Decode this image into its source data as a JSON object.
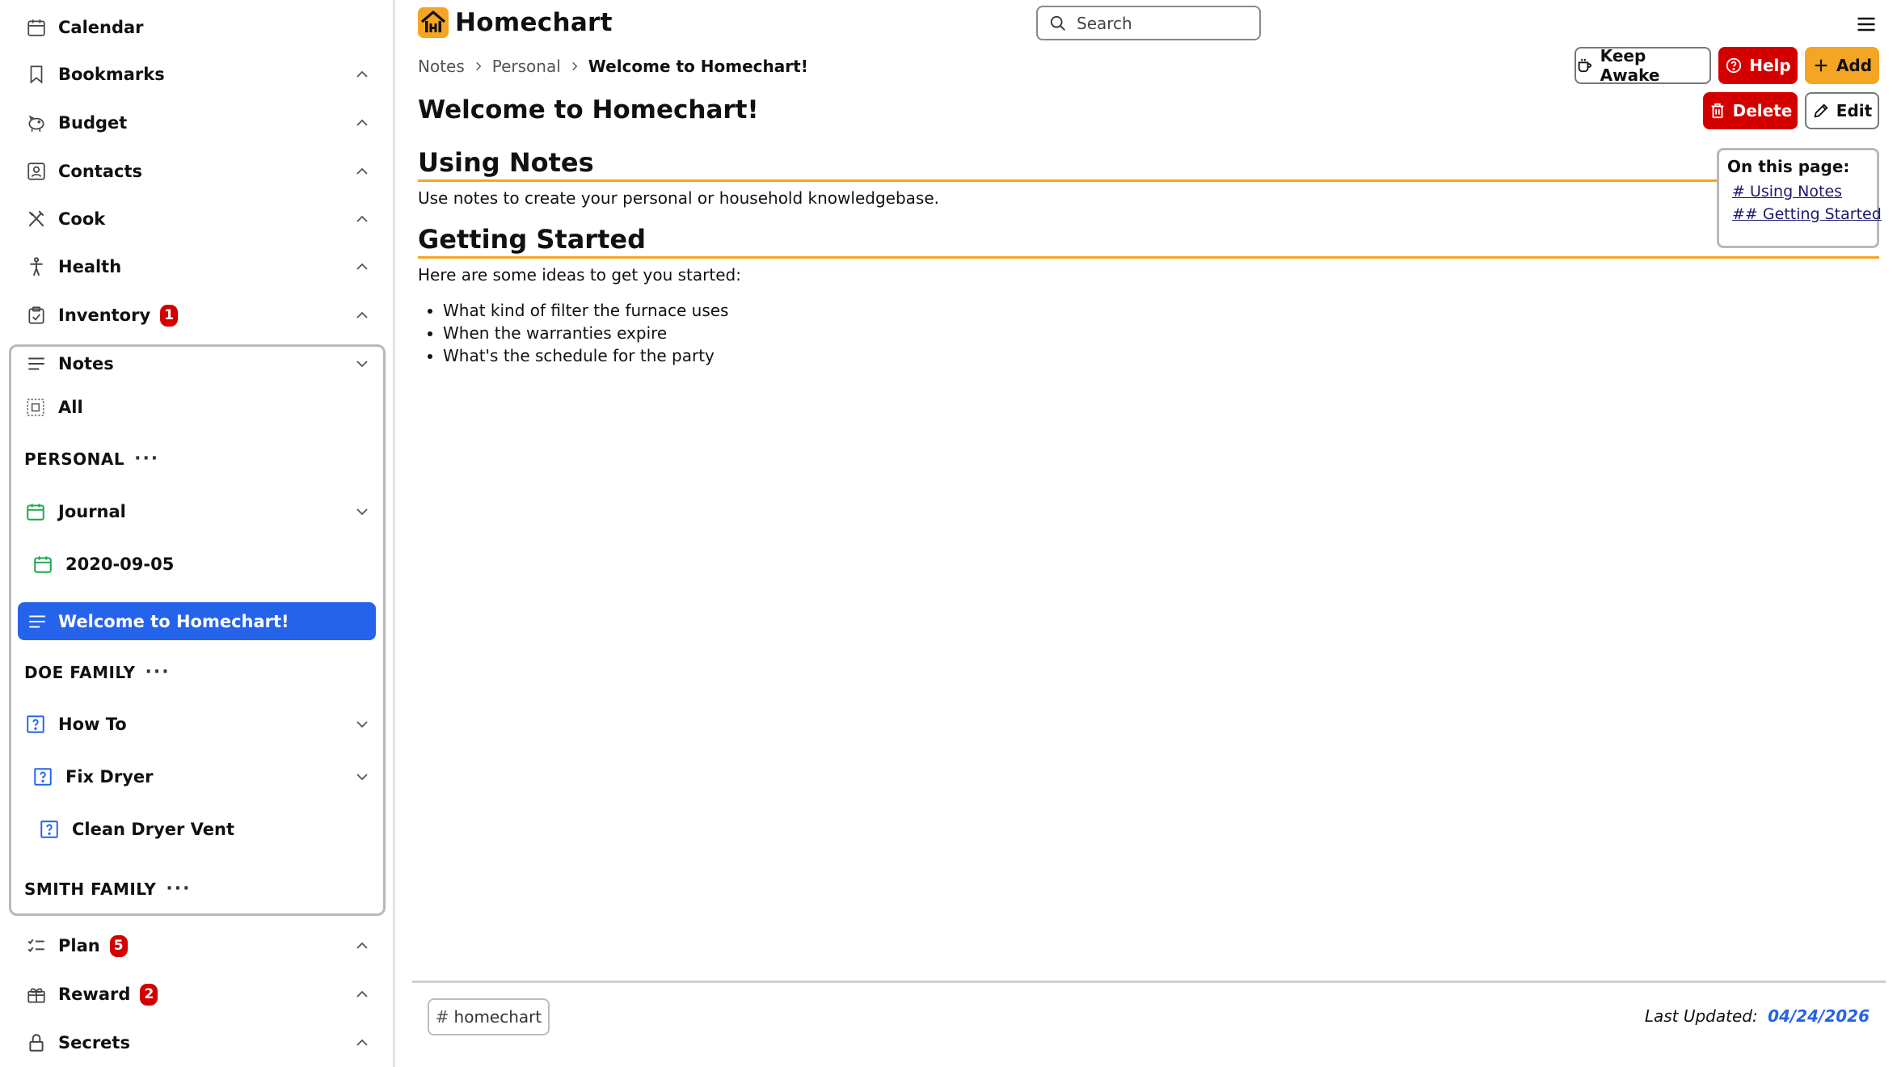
{
  "app": {
    "title": "Homechart"
  },
  "search": {
    "placeholder": "Search"
  },
  "colors": {
    "accent": "#f5a524",
    "primary": "#2563eb",
    "danger": "#d40000",
    "success": "#1aa54a"
  },
  "sidebar": {
    "items": [
      {
        "label": "Calendar",
        "icon": "calendar-icon"
      },
      {
        "label": "Bookmarks",
        "icon": "bookmark-icon"
      },
      {
        "label": "Budget",
        "icon": "piggy-bank-icon"
      },
      {
        "label": "Contacts",
        "icon": "contact-card-icon"
      },
      {
        "label": "Cook",
        "icon": "utensils-icon"
      },
      {
        "label": "Health",
        "icon": "person-icon"
      },
      {
        "label": "Inventory",
        "icon": "clipboard-check-icon",
        "badge": "1"
      },
      {
        "label": "Notes",
        "icon": "notes-lines-icon"
      },
      {
        "label": "Plan",
        "icon": "checklist-icon",
        "badge": "5"
      },
      {
        "label": "Reward",
        "icon": "gift-icon",
        "badge": "2"
      },
      {
        "label": "Secrets",
        "icon": "lock-icon"
      }
    ],
    "notes": {
      "all_label": "All",
      "personal_heading": "PERSONAL",
      "journal_label": "Journal",
      "journal_entry_label": "2020-09-05",
      "active_note_label": "Welcome to Homechart!",
      "doe_heading": "DOE FAMILY",
      "howto_label": "How To",
      "fix_dryer_label": "Fix Dryer",
      "clean_vent_label": "Clean Dryer Vent",
      "smith_heading": "SMITH FAMILY",
      "dots": "···"
    }
  },
  "breadcrumb": {
    "level1": "Notes",
    "level2": "Personal",
    "current": "Welcome to Homechart!"
  },
  "toolbar": {
    "keep_awake_label": "Keep Awake",
    "help_label": "Help",
    "add_label": "Add",
    "delete_label": "Delete",
    "edit_label": "Edit"
  },
  "note": {
    "title": "Welcome to Homechart!",
    "section1_heading": "Using Notes",
    "section1_text": "Use notes to create your personal or household knowledgebase.",
    "section2_heading": "Getting Started",
    "section2_intro": "Here are some ideas to get you started:",
    "ideas": [
      "What kind of filter the furnace uses",
      "When the warranties expire",
      "What's the schedule for the party"
    ]
  },
  "toc": {
    "title": "On this page:",
    "links": [
      "# Using Notes",
      "## Getting Started"
    ]
  },
  "footer": {
    "tag_hash": "#",
    "tag": "homechart",
    "last_updated_label": "Last Updated:",
    "last_updated_date": "04/24/2026"
  }
}
